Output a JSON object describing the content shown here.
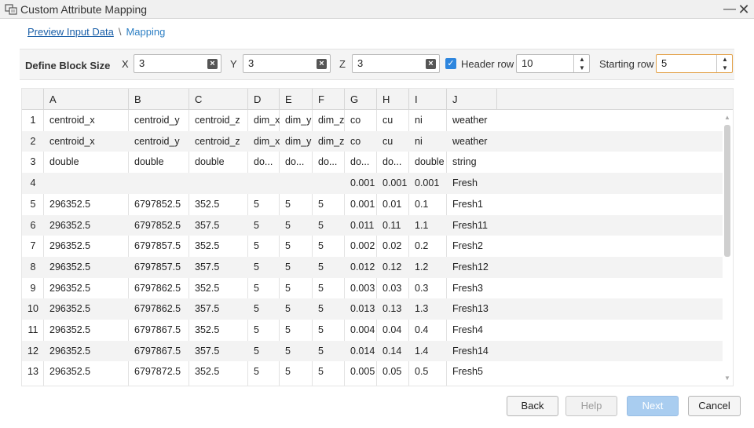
{
  "window": {
    "title": "Custom Attribute Mapping"
  },
  "breadcrumb": {
    "link": "Preview Input Data",
    "separator": "\\",
    "current": "Mapping"
  },
  "block_size": {
    "label": "Define Block Size",
    "x": {
      "label": "X",
      "value": "3"
    },
    "y": {
      "label": "Y",
      "value": "3"
    },
    "z": {
      "label": "Z",
      "value": "3"
    },
    "header_row": {
      "label": "Header row",
      "checked": true,
      "value": "10"
    },
    "starting_row": {
      "label": "Starting row",
      "value": "5"
    }
  },
  "table": {
    "columns": [
      "A",
      "B",
      "C",
      "D",
      "E",
      "F",
      "G",
      "H",
      "I",
      "J"
    ],
    "rows": [
      {
        "n": "1",
        "c": [
          "centroid_x",
          "centroid_y",
          "centroid_z",
          "dim_x",
          "dim_y",
          "dim_z",
          "co",
          "cu",
          "ni",
          "weather"
        ]
      },
      {
        "n": "2",
        "c": [
          "centroid_x",
          "centroid_y",
          "centroid_z",
          "dim_x",
          "dim_y",
          "dim_z",
          "co",
          "cu",
          "ni",
          "weather"
        ]
      },
      {
        "n": "3",
        "c": [
          "double",
          "double",
          "double",
          "do...",
          "do...",
          "do...",
          "do...",
          "do...",
          "double",
          "string"
        ]
      },
      {
        "n": "4",
        "c": [
          "",
          "",
          "",
          "",
          "",
          "",
          "0.001",
          "0.001",
          "0.001",
          "Fresh"
        ]
      },
      {
        "n": "5",
        "c": [
          "296352.5",
          "6797852.5",
          "352.5",
          "5",
          "5",
          "5",
          "0.001",
          "0.01",
          "0.1",
          "Fresh1"
        ]
      },
      {
        "n": "6",
        "c": [
          "296352.5",
          "6797852.5",
          "357.5",
          "5",
          "5",
          "5",
          "0.011",
          "0.11",
          "1.1",
          "Fresh11"
        ]
      },
      {
        "n": "7",
        "c": [
          "296352.5",
          "6797857.5",
          "352.5",
          "5",
          "5",
          "5",
          "0.002",
          "0.02",
          "0.2",
          "Fresh2"
        ]
      },
      {
        "n": "8",
        "c": [
          "296352.5",
          "6797857.5",
          "357.5",
          "5",
          "5",
          "5",
          "0.012",
          "0.12",
          "1.2",
          "Fresh12"
        ]
      },
      {
        "n": "9",
        "c": [
          "296352.5",
          "6797862.5",
          "352.5",
          "5",
          "5",
          "5",
          "0.003",
          "0.03",
          "0.3",
          "Fresh3"
        ]
      },
      {
        "n": "10",
        "c": [
          "296352.5",
          "6797862.5",
          "357.5",
          "5",
          "5",
          "5",
          "0.013",
          "0.13",
          "1.3",
          "Fresh13"
        ]
      },
      {
        "n": "11",
        "c": [
          "296352.5",
          "6797867.5",
          "352.5",
          "5",
          "5",
          "5",
          "0.004",
          "0.04",
          "0.4",
          "Fresh4"
        ]
      },
      {
        "n": "12",
        "c": [
          "296352.5",
          "6797867.5",
          "357.5",
          "5",
          "5",
          "5",
          "0.014",
          "0.14",
          "1.4",
          "Fresh14"
        ]
      },
      {
        "n": "13",
        "c": [
          "296352.5",
          "6797872.5",
          "352.5",
          "5",
          "5",
          "5",
          "0.005",
          "0.05",
          "0.5",
          "Fresh5"
        ]
      }
    ]
  },
  "buttons": {
    "back": "Back",
    "help": "Help",
    "next": "Next",
    "cancel": "Cancel"
  },
  "icons": {
    "minimize": "minimize-icon",
    "close": "close-icon",
    "clear": "clear-icon",
    "check": "checkmark-icon"
  },
  "colors": {
    "accent": "#2e86de",
    "link": "#1a5fa8",
    "next_button": "#a9cdf0",
    "focus_border": "#e3a24a"
  }
}
